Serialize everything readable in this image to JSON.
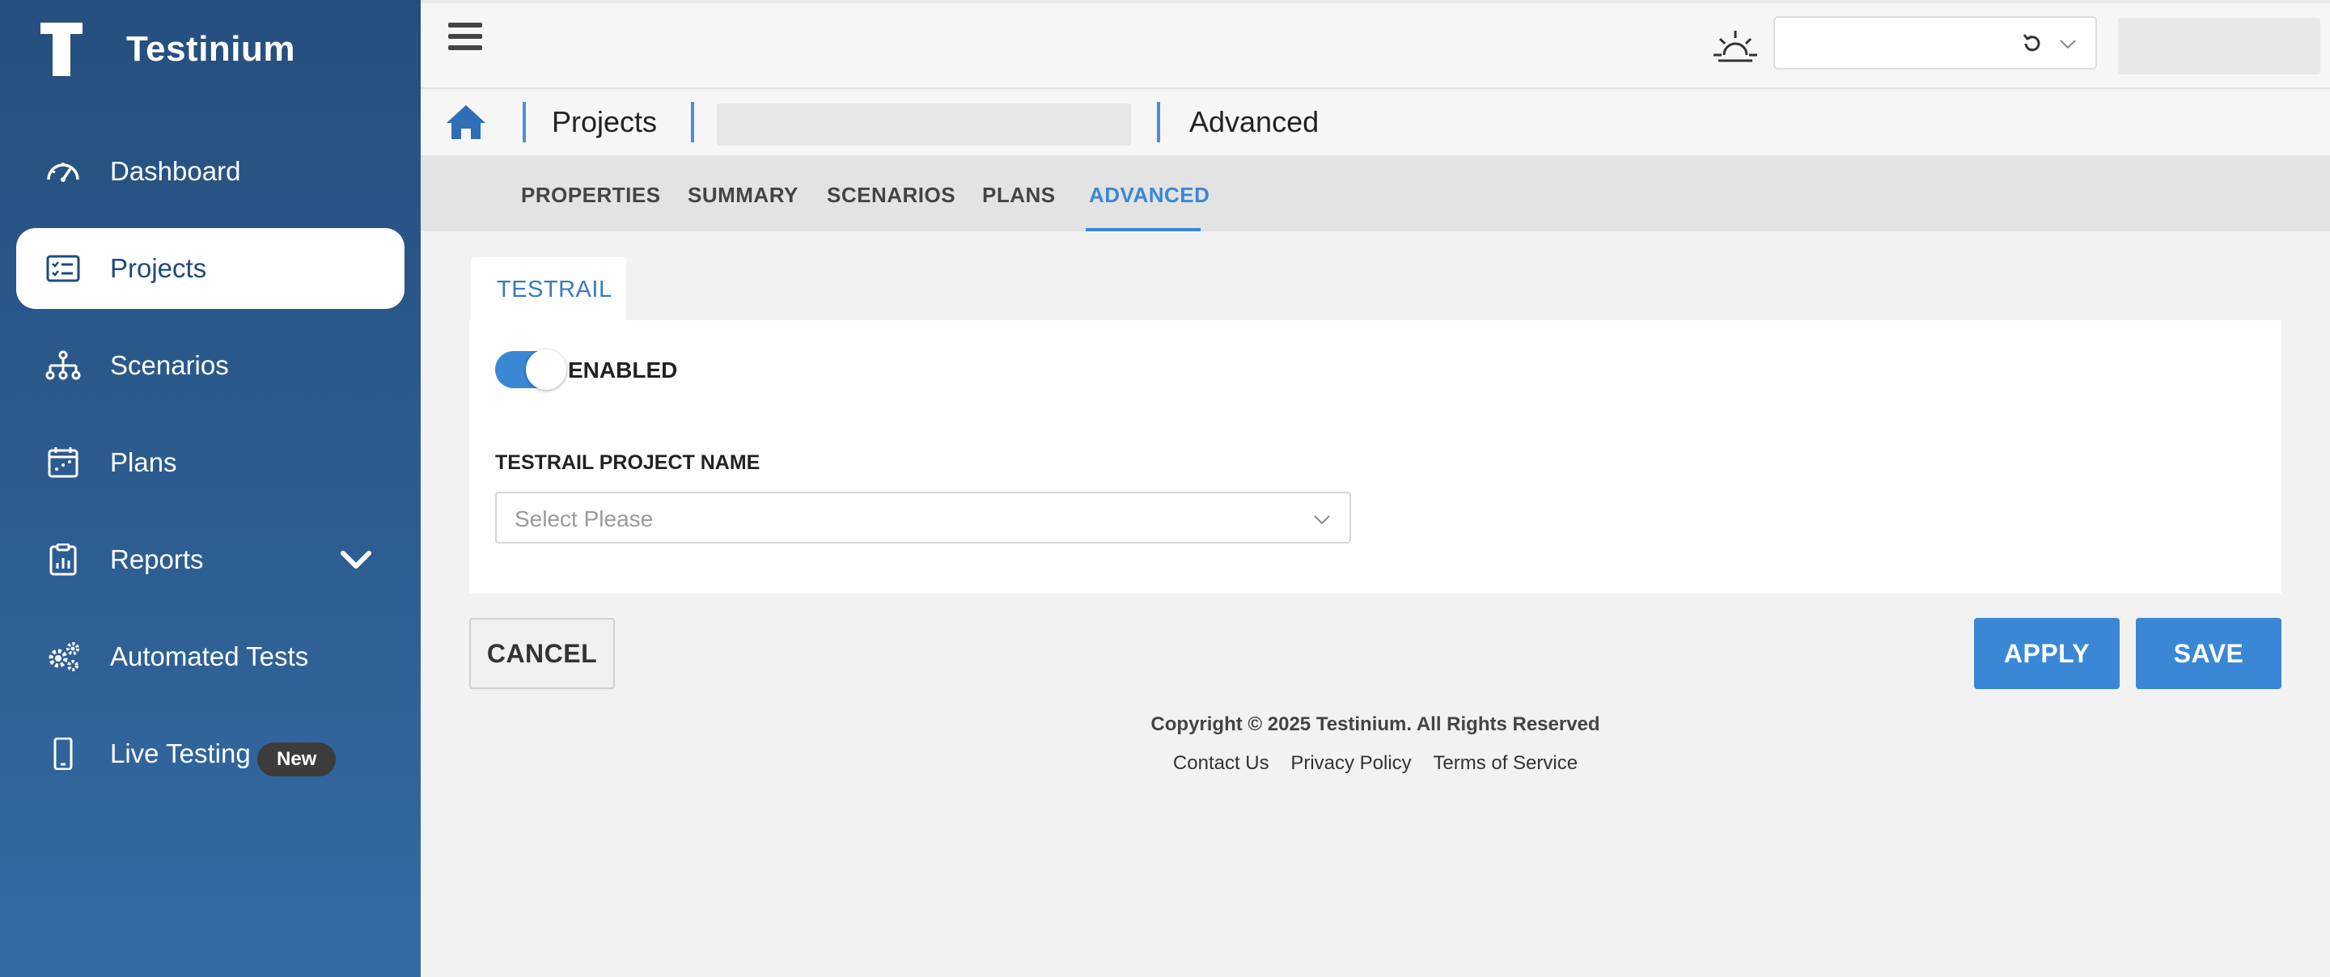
{
  "brand": {
    "name": "Testinium"
  },
  "sidebar": {
    "items": [
      {
        "label": "Dashboard",
        "icon": "gauge-icon"
      },
      {
        "label": "Projects",
        "icon": "checklist-icon",
        "active": true
      },
      {
        "label": "Scenarios",
        "icon": "hierarchy-icon"
      },
      {
        "label": "Plans",
        "icon": "calendar-icon"
      },
      {
        "label": "Reports",
        "icon": "clipboard-chart-icon",
        "expandable": true
      },
      {
        "label": "Automated Tests",
        "icon": "gears-icon"
      },
      {
        "label": "Live Testing",
        "icon": "mobile-icon",
        "badge": "New"
      }
    ]
  },
  "header": {
    "menu_icon": "hamburger-icon",
    "theme_icon": "sunrise-icon"
  },
  "breadcrumb": {
    "projects": "Projects",
    "current": "Advanced"
  },
  "tabs": [
    {
      "label": "PROPERTIES"
    },
    {
      "label": "SUMMARY"
    },
    {
      "label": "SCENARIOS"
    },
    {
      "label": "PLANS"
    },
    {
      "label": "ADVANCED",
      "active": true
    }
  ],
  "subtab": {
    "label": "TESTRAIL"
  },
  "form": {
    "toggle_label": "ENABLED",
    "toggle_on": true,
    "project_name_label": "TESTRAIL PROJECT NAME",
    "project_name_placeholder": "Select Please"
  },
  "actions": {
    "cancel": "CANCEL",
    "apply": "APPLY",
    "save": "SAVE"
  },
  "footer": {
    "copyright": "Copyright © 2025 Testinium. All Rights Reserved",
    "links": [
      "Contact Us",
      "Privacy Policy",
      "Terms of Service"
    ]
  },
  "colors": {
    "accent": "#3a87d6",
    "sidebar": "#2d5d91"
  }
}
